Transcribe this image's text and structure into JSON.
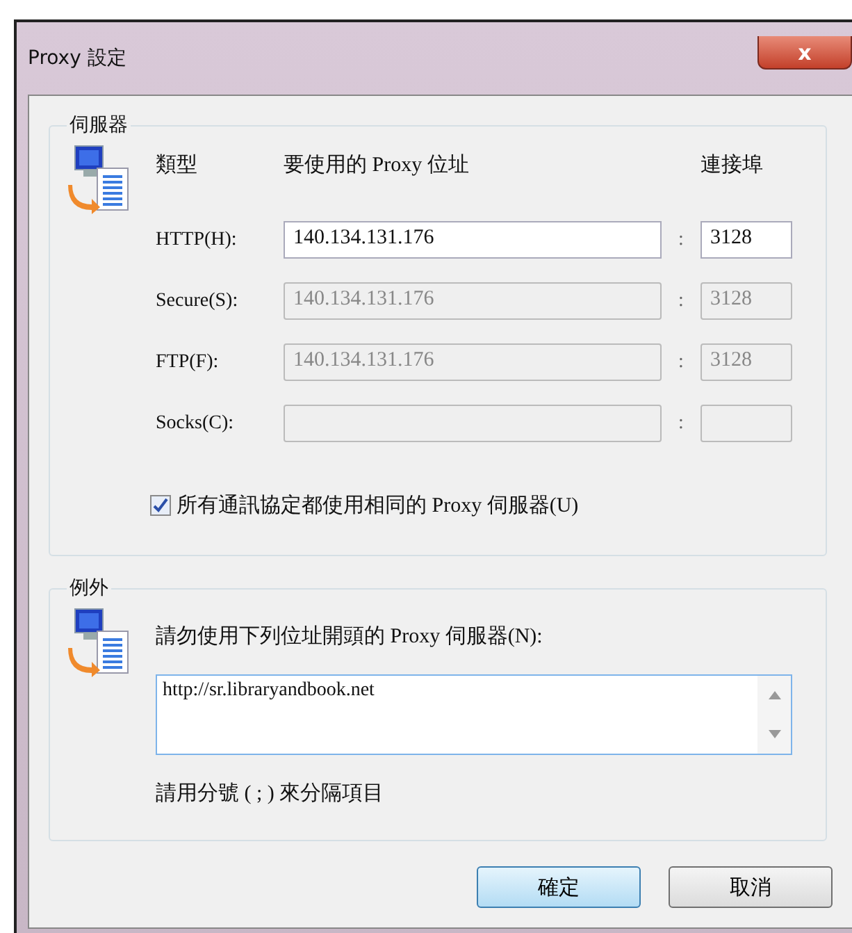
{
  "window": {
    "title": "Proxy 設定",
    "close_label": "x"
  },
  "servers": {
    "legend": "伺服器",
    "headers": {
      "type": "類型",
      "address": "要使用的 Proxy 位址",
      "port": "連接埠"
    },
    "rows": [
      {
        "label": "HTTP(H):",
        "address": "140.134.131.176",
        "separator": ":",
        "port": "3128",
        "disabled": false
      },
      {
        "label": "Secure(S):",
        "address": "140.134.131.176",
        "separator": ":",
        "port": "3128",
        "disabled": true
      },
      {
        "label": "FTP(F):",
        "address": "140.134.131.176",
        "separator": ":",
        "port": "3128",
        "disabled": true
      },
      {
        "label": "Socks(C):",
        "separator": ":",
        "disabled": true
      }
    ],
    "same_proxy": {
      "label": "所有通訊協定都使用相同的 Proxy 伺服器(U)",
      "checked": true
    }
  },
  "exceptions": {
    "legend": "例外",
    "prompt": "請勿使用下列位址開頭的 Proxy 伺服器(N):",
    "value": "http://sr.libraryandbook.net",
    "hint": "請用分號 ( ; ) 來分隔項目"
  },
  "buttons": [
    {
      "label": "確定",
      "default": true
    },
    {
      "label": "取消",
      "default": false
    }
  ]
}
